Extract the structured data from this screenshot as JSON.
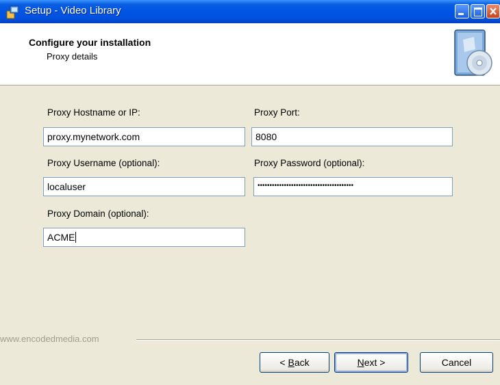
{
  "window": {
    "title": "Setup - Video Library",
    "controls": [
      "minimize-icon",
      "maximize-icon",
      "close-icon"
    ]
  },
  "header": {
    "title": "Configure your installation",
    "subtitle": "Proxy details"
  },
  "form": {
    "hostname_label": "Proxy Hostname or IP:",
    "hostname_value": "proxy.mynetwork.com",
    "port_label": "Proxy Port:",
    "port_value": "8080",
    "username_label": "Proxy Username (optional):",
    "username_value": "localuser",
    "password_label": "Proxy Password (optional):",
    "password_value": "••••••••••••••••••••••••••••••••••••••••",
    "domain_label": "Proxy Domain (optional):",
    "domain_value": "ACME"
  },
  "footer": {
    "brand": "www.encodedmedia.com",
    "back_prefix": "< ",
    "back_hotkey": "B",
    "back_rest": "ack",
    "next_hotkey": "N",
    "next_rest": "ext >",
    "cancel_label": "Cancel"
  },
  "colors": {
    "titlebar": "#0055e5",
    "dialog_background": "#ece9d8",
    "input_border": "#7f9db9",
    "button_border": "#003c74"
  }
}
